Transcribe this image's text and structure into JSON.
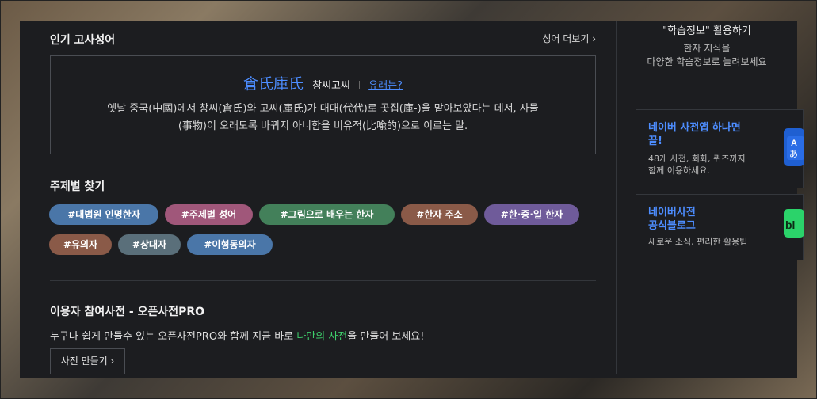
{
  "popular_idioms": {
    "title": "인기 고사성어",
    "more_label": "성어 더보기",
    "idiom": {
      "hanja": "倉氏庫氏",
      "hangul": "창씨고씨",
      "origin_link": "유래는?",
      "description_line1": "옛날 중국(中國)에서 창씨(倉氏)와 고씨(庫氏)가 대대(代代)로 곳집(庫-)을 맡아보았다는 데서, 사물",
      "description_line2": "(事物)이 오래도록 바뀌지 아니함을 비유적(比喩的)으로 이르는 말."
    }
  },
  "topics": {
    "title": "주제별 찾기",
    "tags": [
      {
        "label": "#대법원 인명한자",
        "color": "#4a76a8"
      },
      {
        "label": "#주제별 성어",
        "color": "#a0577a"
      },
      {
        "label": "#그림으로 배우는 한자",
        "color": "#43805a"
      },
      {
        "label": "#한자 주소",
        "color": "#8a5a48"
      },
      {
        "label": "#한·중·일 한자",
        "color": "#6f5b9a"
      },
      {
        "label": "#유의자",
        "color": "#8a5a48"
      },
      {
        "label": "#상대자",
        "color": "#5a6f7a"
      },
      {
        "label": "#이형동의자",
        "color": "#4a76a8"
      }
    ]
  },
  "open_dict": {
    "title": "이용자 참여사전 - 오픈사전PRO",
    "desc_before": "누구나 쉽게 만들수 있는 오픈사전PRO와 함께 지금 바로 ",
    "desc_highlight": "나만의 사전",
    "desc_after": "을 만들어 보세요!",
    "button_label": "사전 만들기"
  },
  "side": {
    "title": "\"학습정보\" 활용하기",
    "subtitle_line1": "한자 지식을",
    "subtitle_line2": "다양한 학습정보로 늘려보세요",
    "promos": [
      {
        "title_line1": "네이버 사전앱 하나면",
        "title_line2": "끝!",
        "desc_line1": "48개 사전, 회화, 퀴즈까지",
        "desc_line2": "함께 이용하세요.",
        "icon_color": "#1f5fd1",
        "icon_text": "A\nあ"
      },
      {
        "title_line1": "네이버사전",
        "title_line2": "공식블로그",
        "desc_line1": "새로운 소식, 편리한 활용팁",
        "desc_line2": "",
        "icon_color": "#2bd36a",
        "icon_text": "bl"
      }
    ]
  },
  "colors": {
    "accent_blue": "#4d8dff",
    "accent_green": "#3ecf6b",
    "panel_bg": "#1c1d20"
  }
}
